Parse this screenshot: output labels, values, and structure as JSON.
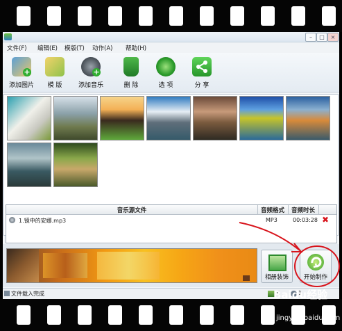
{
  "window": {
    "min_label": "–",
    "max_label": "□",
    "close_label": "×"
  },
  "menu": {
    "items": [
      {
        "label": "文件(F)"
      },
      {
        "label": "编辑(E)"
      },
      {
        "label": "模版(T)"
      },
      {
        "label": "动作(A)"
      },
      {
        "label": "帮助(H)"
      }
    ]
  },
  "toolbar": {
    "items": [
      {
        "label": "添加图片",
        "icon": "add-picture-icon"
      },
      {
        "label": "模 版",
        "icon": "template-icon"
      },
      {
        "label": "添加音乐",
        "icon": "add-music-icon"
      },
      {
        "label": "删 除",
        "icon": "trash-icon"
      },
      {
        "label": "选 项",
        "icon": "options-gear-icon"
      },
      {
        "label": "分 享",
        "icon": "share-icon"
      }
    ]
  },
  "gallery": {
    "thumbnails": [
      {
        "name": "living-room"
      },
      {
        "name": "village-rooftops"
      },
      {
        "name": "tropical-houses"
      },
      {
        "name": "mountain-lake"
      },
      {
        "name": "wooden-huts"
      },
      {
        "name": "autumn-tree"
      },
      {
        "name": "river-sunset"
      },
      {
        "name": "rocky-river"
      },
      {
        "name": "forest-cottage"
      }
    ]
  },
  "music": {
    "columns": {
      "source": "音乐源文件",
      "format": "音频格式",
      "duration": "音频时长"
    },
    "rows": [
      {
        "file": "1.镜中的安娜.mp3",
        "format": "MP3",
        "duration": "00:03:28"
      }
    ],
    "delete_symbol": "✖"
  },
  "actions": {
    "album_decoration": "相册装饰",
    "start": "开始制作"
  },
  "status": {
    "text": "文件载入完成",
    "picture_count": "9",
    "music_count": "1"
  },
  "watermark": {
    "brand": "Baidu经验",
    "url": "jingyan.baidu.com"
  },
  "colors": {
    "accent_green": "#2fae2f",
    "highlight_red": "#d8141c",
    "preview_orange": "#f39a12"
  }
}
